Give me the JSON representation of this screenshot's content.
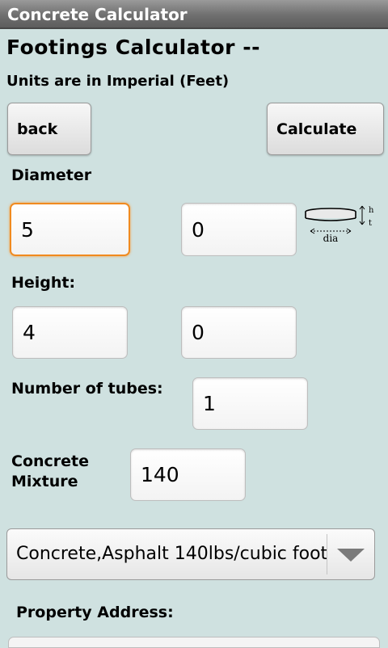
{
  "app": {
    "title": "Concrete Calculator"
  },
  "page": {
    "heading": "Footings Calculator --",
    "units_note": "Units are in Imperial (Feet)"
  },
  "buttons": {
    "back": "back",
    "calculate": "Calculate"
  },
  "fields": {
    "diameter": {
      "label": "Diameter",
      "feet": "5",
      "inches": "0"
    },
    "height": {
      "label": "Height:",
      "feet": "4",
      "inches": "0"
    },
    "tubes": {
      "label": "Number of tubes:",
      "value": "1"
    },
    "mixture": {
      "label_line1": "Concrete",
      "label_line2": "Mixture",
      "value": "140"
    }
  },
  "diagram": {
    "dia_label": "dia",
    "h_label": "h",
    "t_label": "t"
  },
  "spinner": {
    "selected": "Concrete,Asphalt 140lbs/cubic foot"
  },
  "address": {
    "label": "Property Address:"
  }
}
